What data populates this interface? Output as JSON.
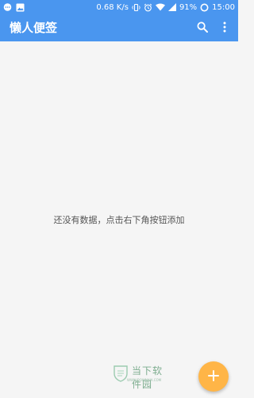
{
  "status_bar": {
    "network_speed": "0.68 K/s",
    "battery": "91%",
    "time": "15:00",
    "left_icons": [
      "chat-bubble-icon",
      "image-icon"
    ],
    "right_icons": [
      "vibrate-icon",
      "alarm-icon",
      "wifi-icon",
      "signal-icon",
      "battery-ring-icon"
    ]
  },
  "toolbar": {
    "title": "懒人便签",
    "actions": [
      "search-icon",
      "more-vert-icon"
    ]
  },
  "main": {
    "empty_message": "还没有数据，点击右下角按钮添加"
  },
  "watermark": {
    "logo_text": "当下软件园",
    "sub_text": "WWW.DOWNXIA.COM"
  },
  "fab": {
    "icon": "plus-icon"
  },
  "colors": {
    "primary": "#4a96ef",
    "background": "#f5f5f5",
    "accent": "#ffb547"
  }
}
